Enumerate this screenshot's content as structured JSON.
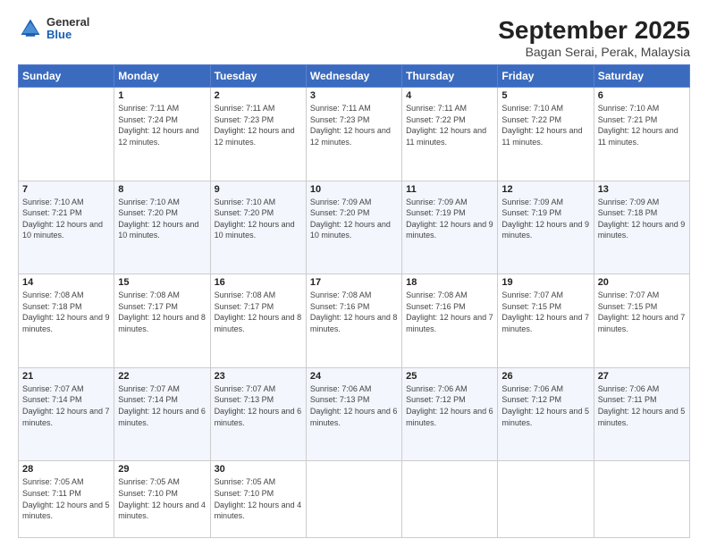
{
  "logo": {
    "general": "General",
    "blue": "Blue"
  },
  "title": "September 2025",
  "subtitle": "Bagan Serai, Perak, Malaysia",
  "days_header": [
    "Sunday",
    "Monday",
    "Tuesday",
    "Wednesday",
    "Thursday",
    "Friday",
    "Saturday"
  ],
  "weeks": [
    [
      {
        "day": "",
        "sunrise": "",
        "sunset": "",
        "daylight": ""
      },
      {
        "day": "1",
        "sunrise": "Sunrise: 7:11 AM",
        "sunset": "Sunset: 7:24 PM",
        "daylight": "Daylight: 12 hours and 12 minutes."
      },
      {
        "day": "2",
        "sunrise": "Sunrise: 7:11 AM",
        "sunset": "Sunset: 7:23 PM",
        "daylight": "Daylight: 12 hours and 12 minutes."
      },
      {
        "day": "3",
        "sunrise": "Sunrise: 7:11 AM",
        "sunset": "Sunset: 7:23 PM",
        "daylight": "Daylight: 12 hours and 12 minutes."
      },
      {
        "day": "4",
        "sunrise": "Sunrise: 7:11 AM",
        "sunset": "Sunset: 7:22 PM",
        "daylight": "Daylight: 12 hours and 11 minutes."
      },
      {
        "day": "5",
        "sunrise": "Sunrise: 7:10 AM",
        "sunset": "Sunset: 7:22 PM",
        "daylight": "Daylight: 12 hours and 11 minutes."
      },
      {
        "day": "6",
        "sunrise": "Sunrise: 7:10 AM",
        "sunset": "Sunset: 7:21 PM",
        "daylight": "Daylight: 12 hours and 11 minutes."
      }
    ],
    [
      {
        "day": "7",
        "sunrise": "Sunrise: 7:10 AM",
        "sunset": "Sunset: 7:21 PM",
        "daylight": "Daylight: 12 hours and 10 minutes."
      },
      {
        "day": "8",
        "sunrise": "Sunrise: 7:10 AM",
        "sunset": "Sunset: 7:20 PM",
        "daylight": "Daylight: 12 hours and 10 minutes."
      },
      {
        "day": "9",
        "sunrise": "Sunrise: 7:10 AM",
        "sunset": "Sunset: 7:20 PM",
        "daylight": "Daylight: 12 hours and 10 minutes."
      },
      {
        "day": "10",
        "sunrise": "Sunrise: 7:09 AM",
        "sunset": "Sunset: 7:20 PM",
        "daylight": "Daylight: 12 hours and 10 minutes."
      },
      {
        "day": "11",
        "sunrise": "Sunrise: 7:09 AM",
        "sunset": "Sunset: 7:19 PM",
        "daylight": "Daylight: 12 hours and 9 minutes."
      },
      {
        "day": "12",
        "sunrise": "Sunrise: 7:09 AM",
        "sunset": "Sunset: 7:19 PM",
        "daylight": "Daylight: 12 hours and 9 minutes."
      },
      {
        "day": "13",
        "sunrise": "Sunrise: 7:09 AM",
        "sunset": "Sunset: 7:18 PM",
        "daylight": "Daylight: 12 hours and 9 minutes."
      }
    ],
    [
      {
        "day": "14",
        "sunrise": "Sunrise: 7:08 AM",
        "sunset": "Sunset: 7:18 PM",
        "daylight": "Daylight: 12 hours and 9 minutes."
      },
      {
        "day": "15",
        "sunrise": "Sunrise: 7:08 AM",
        "sunset": "Sunset: 7:17 PM",
        "daylight": "Daylight: 12 hours and 8 minutes."
      },
      {
        "day": "16",
        "sunrise": "Sunrise: 7:08 AM",
        "sunset": "Sunset: 7:17 PM",
        "daylight": "Daylight: 12 hours and 8 minutes."
      },
      {
        "day": "17",
        "sunrise": "Sunrise: 7:08 AM",
        "sunset": "Sunset: 7:16 PM",
        "daylight": "Daylight: 12 hours and 8 minutes."
      },
      {
        "day": "18",
        "sunrise": "Sunrise: 7:08 AM",
        "sunset": "Sunset: 7:16 PM",
        "daylight": "Daylight: 12 hours and 7 minutes."
      },
      {
        "day": "19",
        "sunrise": "Sunrise: 7:07 AM",
        "sunset": "Sunset: 7:15 PM",
        "daylight": "Daylight: 12 hours and 7 minutes."
      },
      {
        "day": "20",
        "sunrise": "Sunrise: 7:07 AM",
        "sunset": "Sunset: 7:15 PM",
        "daylight": "Daylight: 12 hours and 7 minutes."
      }
    ],
    [
      {
        "day": "21",
        "sunrise": "Sunrise: 7:07 AM",
        "sunset": "Sunset: 7:14 PM",
        "daylight": "Daylight: 12 hours and 7 minutes."
      },
      {
        "day": "22",
        "sunrise": "Sunrise: 7:07 AM",
        "sunset": "Sunset: 7:14 PM",
        "daylight": "Daylight: 12 hours and 6 minutes."
      },
      {
        "day": "23",
        "sunrise": "Sunrise: 7:07 AM",
        "sunset": "Sunset: 7:13 PM",
        "daylight": "Daylight: 12 hours and 6 minutes."
      },
      {
        "day": "24",
        "sunrise": "Sunrise: 7:06 AM",
        "sunset": "Sunset: 7:13 PM",
        "daylight": "Daylight: 12 hours and 6 minutes."
      },
      {
        "day": "25",
        "sunrise": "Sunrise: 7:06 AM",
        "sunset": "Sunset: 7:12 PM",
        "daylight": "Daylight: 12 hours and 6 minutes."
      },
      {
        "day": "26",
        "sunrise": "Sunrise: 7:06 AM",
        "sunset": "Sunset: 7:12 PM",
        "daylight": "Daylight: 12 hours and 5 minutes."
      },
      {
        "day": "27",
        "sunrise": "Sunrise: 7:06 AM",
        "sunset": "Sunset: 7:11 PM",
        "daylight": "Daylight: 12 hours and 5 minutes."
      }
    ],
    [
      {
        "day": "28",
        "sunrise": "Sunrise: 7:05 AM",
        "sunset": "Sunset: 7:11 PM",
        "daylight": "Daylight: 12 hours and 5 minutes."
      },
      {
        "day": "29",
        "sunrise": "Sunrise: 7:05 AM",
        "sunset": "Sunset: 7:10 PM",
        "daylight": "Daylight: 12 hours and 4 minutes."
      },
      {
        "day": "30",
        "sunrise": "Sunrise: 7:05 AM",
        "sunset": "Sunset: 7:10 PM",
        "daylight": "Daylight: 12 hours and 4 minutes."
      },
      {
        "day": "",
        "sunrise": "",
        "sunset": "",
        "daylight": ""
      },
      {
        "day": "",
        "sunrise": "",
        "sunset": "",
        "daylight": ""
      },
      {
        "day": "",
        "sunrise": "",
        "sunset": "",
        "daylight": ""
      },
      {
        "day": "",
        "sunrise": "",
        "sunset": "",
        "daylight": ""
      }
    ]
  ]
}
